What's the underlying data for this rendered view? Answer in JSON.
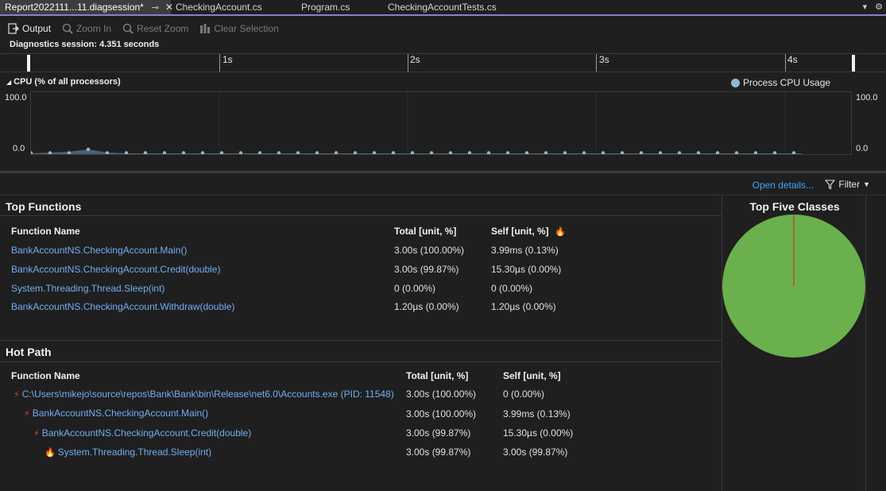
{
  "tabs": [
    {
      "label": "Report2022111...11.diagsession*",
      "active": true
    },
    {
      "label": "CheckingAccount.cs",
      "active": false
    },
    {
      "label": "Program.cs",
      "active": false
    },
    {
      "label": "CheckingAccountTests.cs",
      "active": false
    }
  ],
  "toolbar": {
    "output_label": "Output",
    "zoom_in_label": "Zoom In",
    "reset_zoom_label": "Reset Zoom",
    "clear_selection_label": "Clear Selection"
  },
  "session": {
    "text": "Diagnostics session: 4.351 seconds"
  },
  "ruler": {
    "labels": [
      "1s",
      "2s",
      "3s",
      "4s"
    ]
  },
  "cpu": {
    "title": "CPU (% of all processors)",
    "legend": "Process CPU Usage",
    "y_max": "100.0",
    "y_min": "0.0",
    "color": "#8fb8d6"
  },
  "details": {
    "open_details": "Open details...",
    "filter": "Filter"
  },
  "top_functions": {
    "title": "Top Functions",
    "headers": {
      "name": "Function Name",
      "total": "Total [unit, %]",
      "self": "Self [unit, %]"
    },
    "rows": [
      {
        "name": "BankAccountNS.CheckingAccount.Main()",
        "total": "3.00s (100.00%)",
        "self": "3.99ms (0.13%)"
      },
      {
        "name": "BankAccountNS.CheckingAccount.Credit(double)",
        "total": "3.00s (99.87%)",
        "self": "15.30µs (0.00%)"
      },
      {
        "name": "System.Threading.Thread.Sleep(int)",
        "total": "0 (0.00%)",
        "self": "0 (0.00%)"
      },
      {
        "name": "BankAccountNS.CheckingAccount.Withdraw(double)",
        "total": "1.20µs (0.00%)",
        "self": "1.20µs (0.00%)"
      }
    ]
  },
  "hot_path": {
    "title": "Hot Path",
    "headers": {
      "name": "Function Name",
      "total": "Total [unit, %]",
      "self": "Self [unit, %]"
    },
    "rows": [
      {
        "name": "C:\\Users\\mikejo\\source\\repos\\Bank\\Bank\\bin\\Release\\net6.0\\Accounts.exe (PID: 11548)",
        "total": "3.00s (100.00%)",
        "self": "0 (0.00%)"
      },
      {
        "name": "BankAccountNS.CheckingAccount.Main()",
        "total": "3.00s (100.00%)",
        "self": "3.99ms (0.13%)"
      },
      {
        "name": "BankAccountNS.CheckingAccount.Credit(double)",
        "total": "3.00s (99.87%)",
        "self": "15.30µs (0.00%)"
      },
      {
        "name": "System.Threading.Thread.Sleep(int)",
        "total": "3.00s (99.87%)",
        "self": "3.00s (99.87%)"
      }
    ]
  },
  "top_classes": {
    "title": "Top Five Classes",
    "colors": [
      "#6ab04c",
      "#c0392b"
    ]
  }
}
